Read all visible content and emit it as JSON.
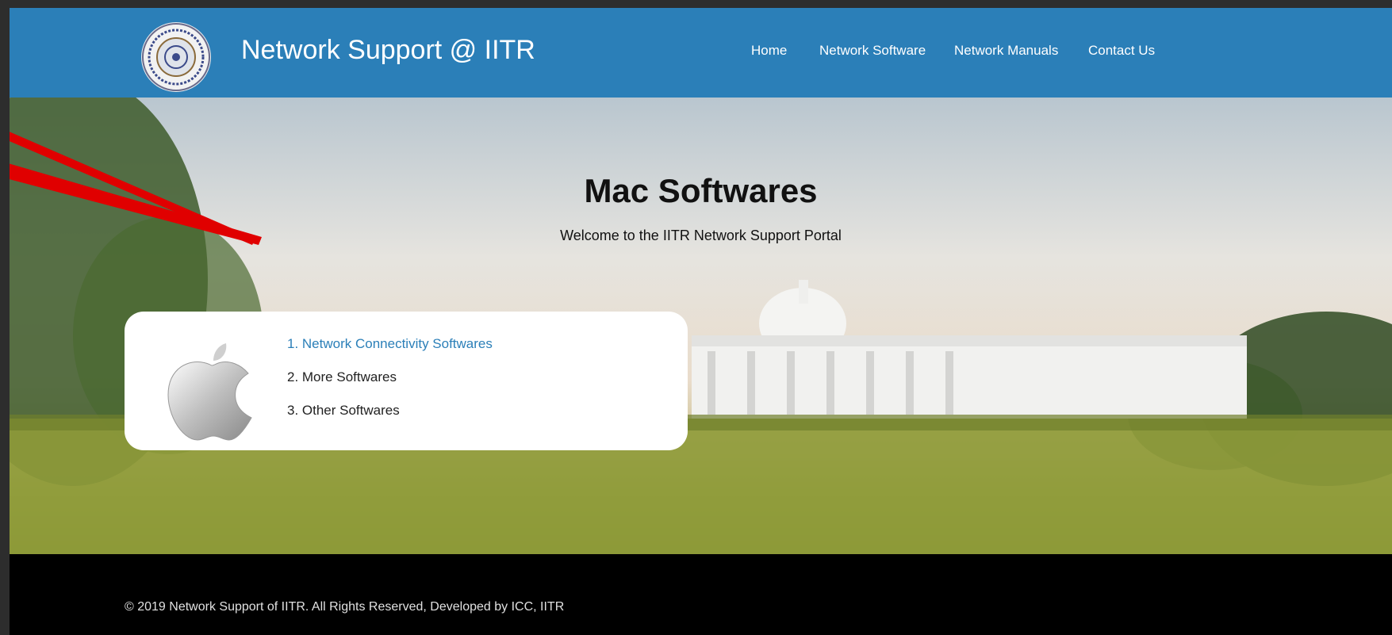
{
  "header": {
    "brand": "Network Support @ IITR",
    "nav": [
      {
        "label": "Home"
      },
      {
        "label": "Network Software"
      },
      {
        "label": "Network Manuals"
      },
      {
        "label": "Contact Us"
      }
    ],
    "color": "#2b7fb8"
  },
  "hero": {
    "title": "Mac Softwares",
    "subtitle": "Welcome to the IITR Network Support Portal"
  },
  "card": {
    "items": [
      {
        "label": "1. Network Connectivity Softwares"
      },
      {
        "label": "2. More Softwares"
      },
      {
        "label": "3. Other Softwares"
      }
    ],
    "logo_icon": "apple-icon"
  },
  "footer": {
    "text": "© 2019 Network Support of IITR. All Rights Reserved, Developed by ICC, IITR"
  },
  "annotation": {
    "icon": "red-arrow-annotation",
    "color": "#e00000"
  }
}
